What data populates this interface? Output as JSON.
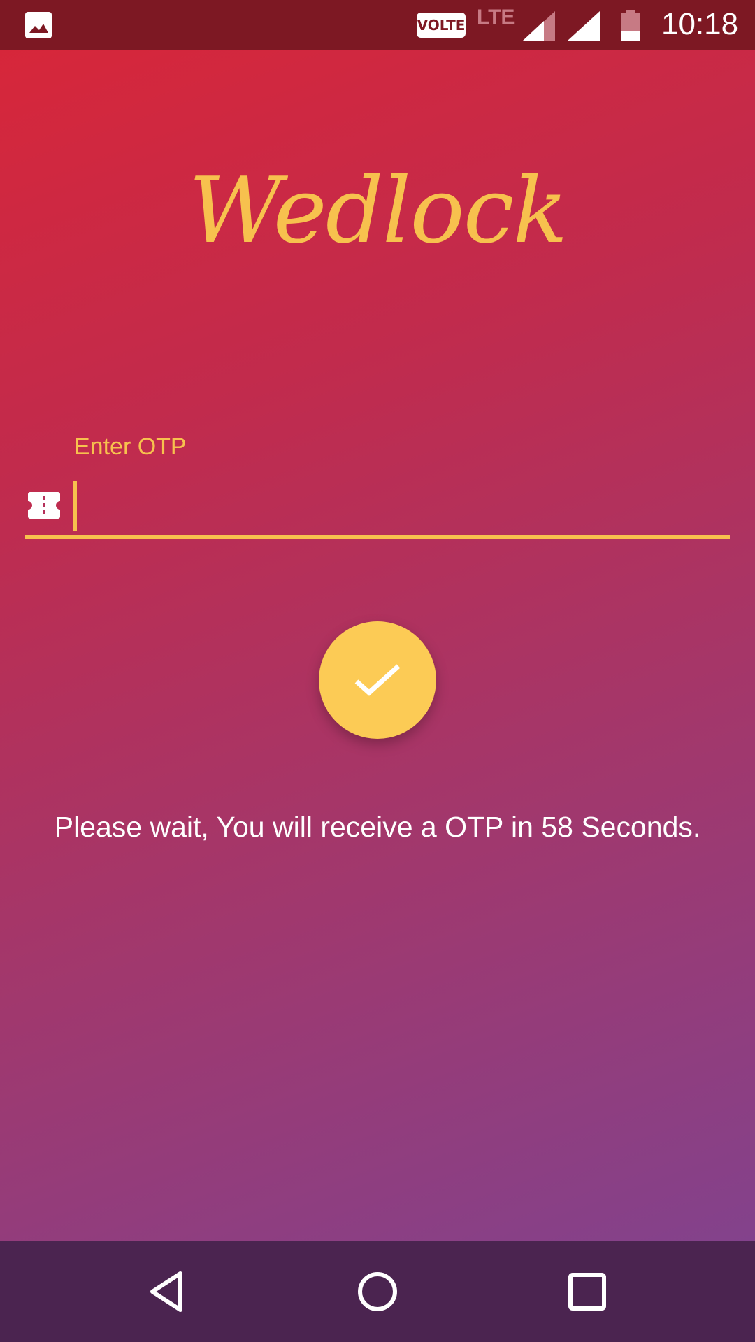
{
  "status_bar": {
    "gallery_icon": "image-icon",
    "volte_label": "VOLTE",
    "network_label": "LTE",
    "time": "10:18"
  },
  "app": {
    "logo_text": "Wedlock"
  },
  "otp": {
    "label": "Enter OTP",
    "value": "",
    "icon": "ticket-icon"
  },
  "submit": {
    "icon": "check-icon"
  },
  "wait_message": "Please wait, You will receive a OTP in 58 Seconds.",
  "nav": {
    "back_icon": "back-icon",
    "home_icon": "home-icon",
    "recents_icon": "recents-icon"
  },
  "colors": {
    "accent": "#f7c14e",
    "button": "#fccb55",
    "status_bar": "#7d1823",
    "nav_bar": "#4b2450",
    "gradient_start": "#d92638",
    "gradient_end": "#7d4492"
  }
}
